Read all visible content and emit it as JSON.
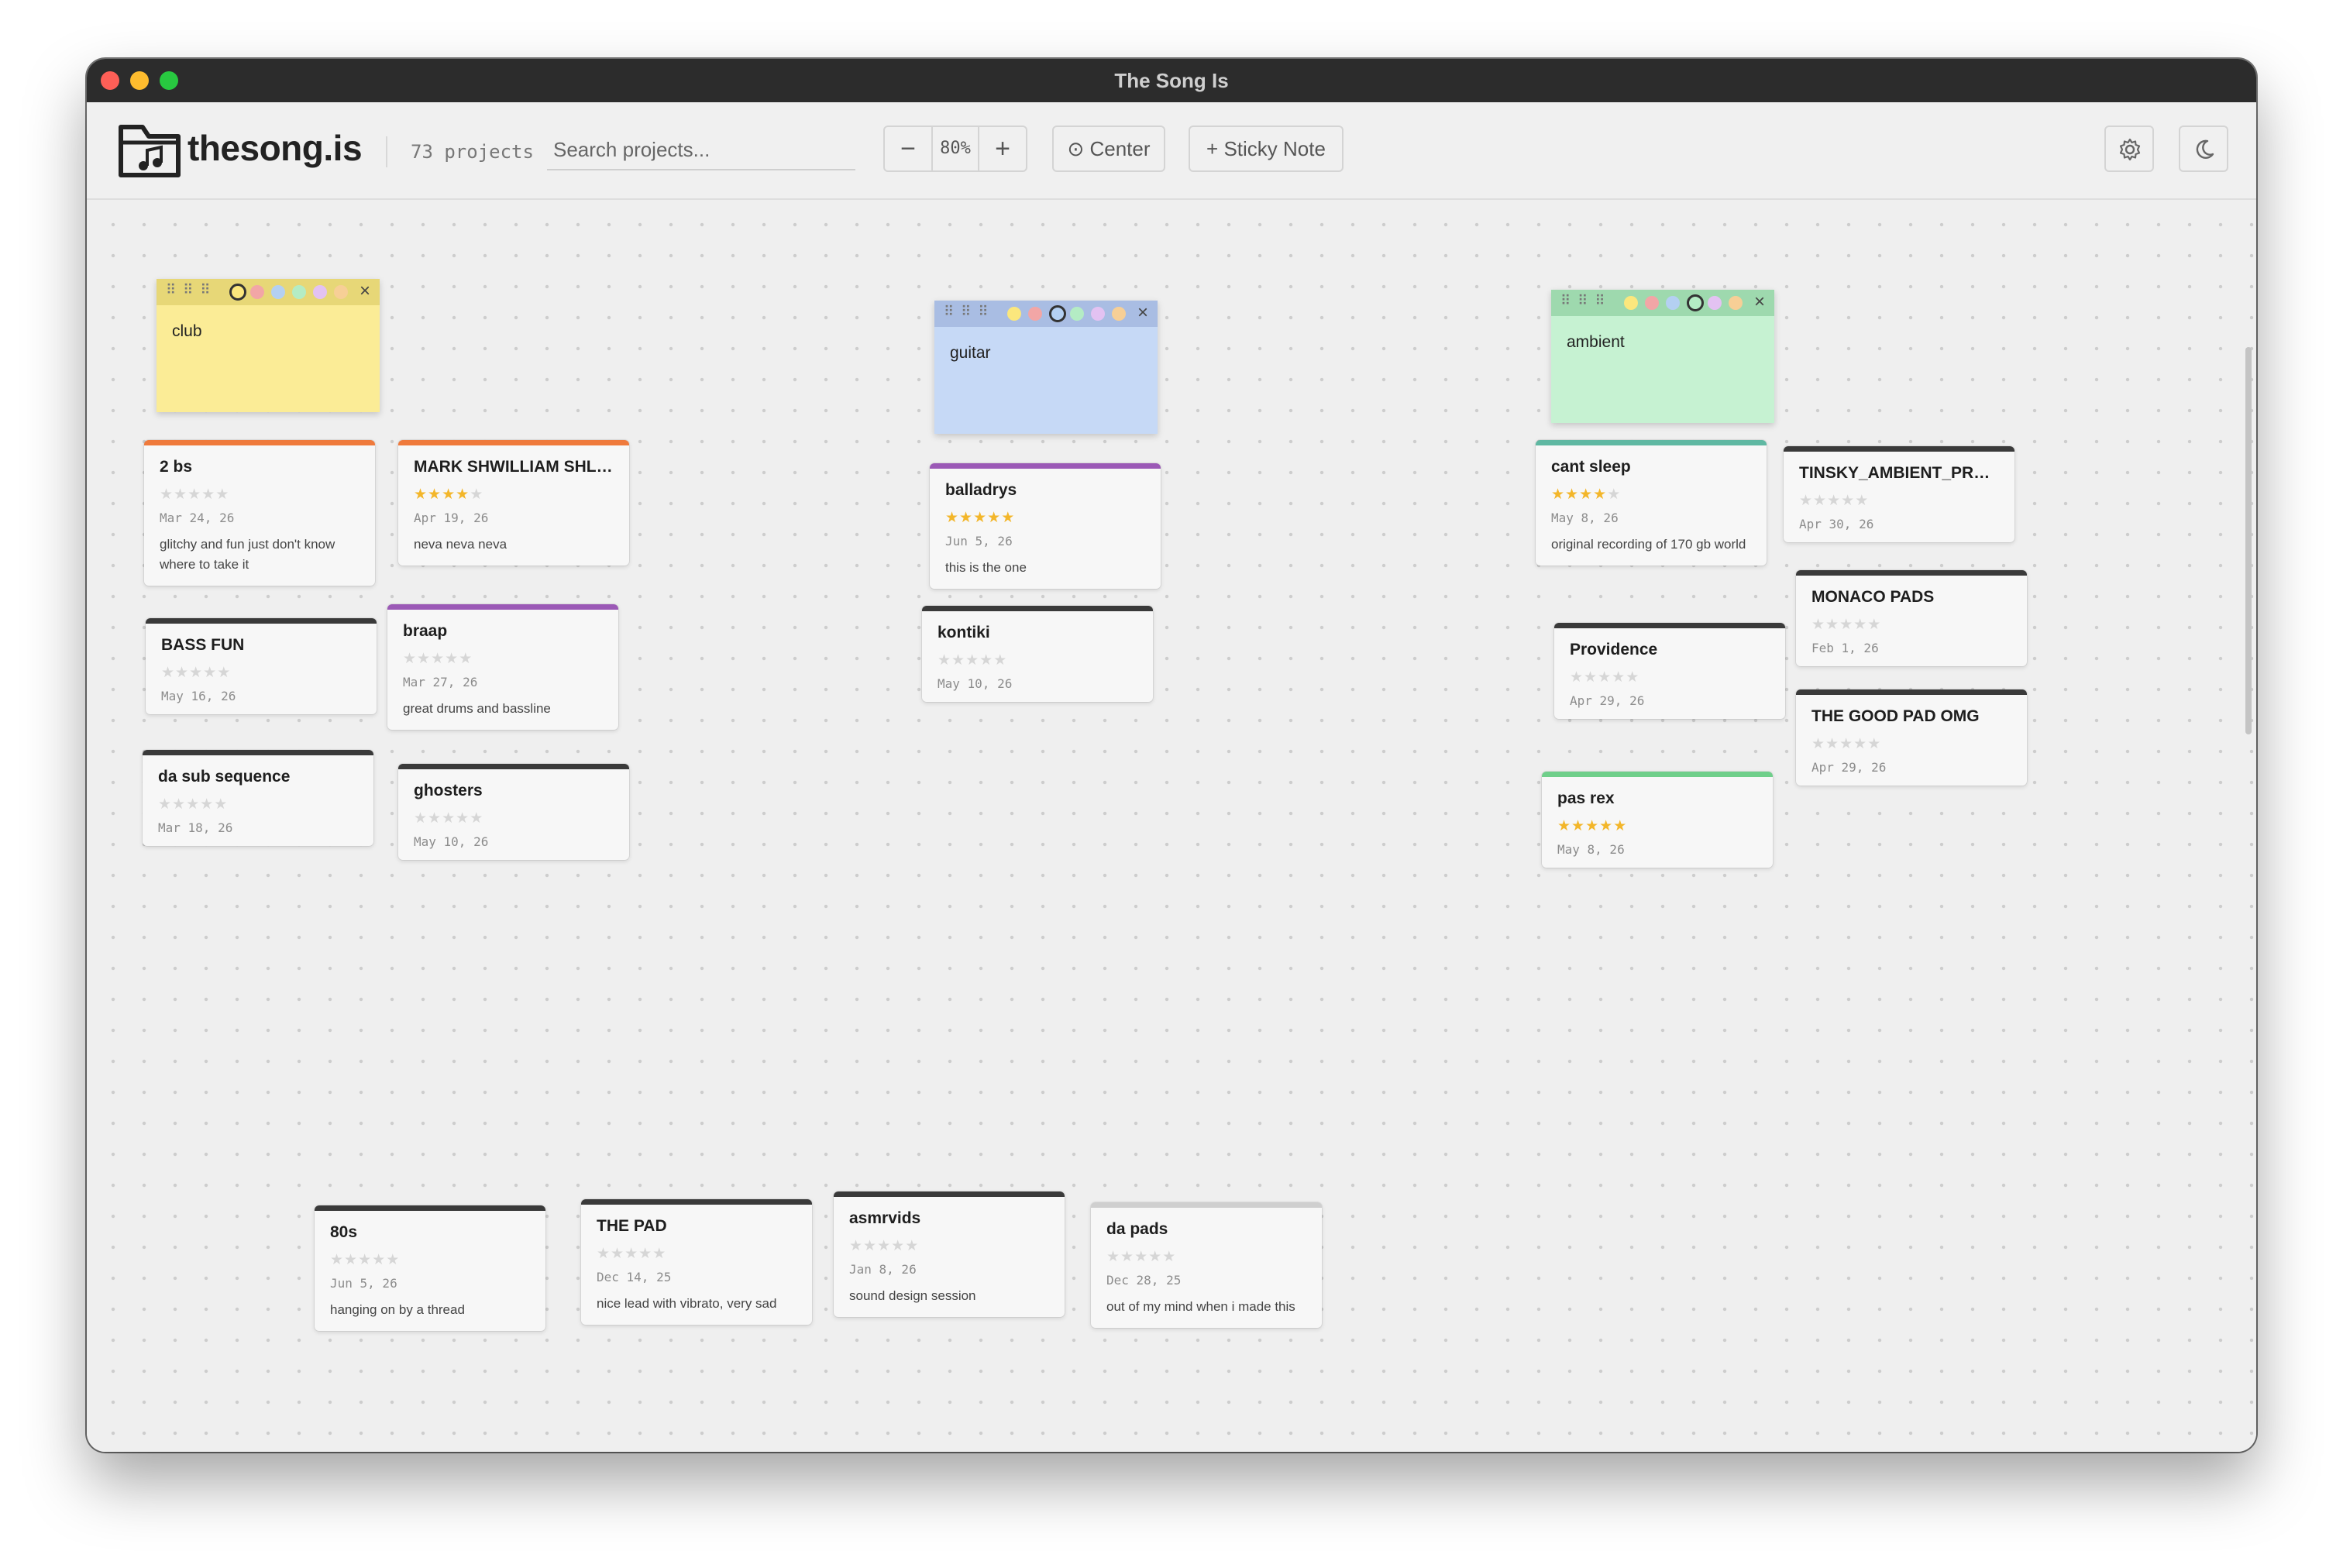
{
  "window": {
    "title": "The Song Is"
  },
  "toolbar": {
    "brand": "thesong.is",
    "project_count": "73 projects",
    "search_placeholder": "Search projects...",
    "zoom": {
      "minus": "−",
      "value": "80%",
      "plus": "+"
    },
    "center_label": "⊙ Center",
    "sticky_label": "+ Sticky Note",
    "settings_icon": "gear-icon",
    "theme_icon": "moon-icon"
  },
  "stickies": [
    {
      "text": "club",
      "color": "#fbec96",
      "head_color": "#e7d777",
      "selected_swatch": 0
    },
    {
      "text": "guitar",
      "color": "#c6d9f6",
      "head_color": "#a9bde3",
      "selected_swatch": 2
    },
    {
      "text": "ambient",
      "color": "#c6f2d2",
      "head_color": "#9ed9ae",
      "selected_swatch": 3
    }
  ],
  "swatch_colors": [
    "#fbe77d",
    "#f2a6a6",
    "#b4d0f2",
    "#b4ecc4",
    "#e3c2f2",
    "#f7cf96"
  ],
  "projects": [
    {
      "title": "2 bs",
      "rating": 0,
      "date": "Mar 24, 26",
      "note": "glitchy and fun just don't know where to take it",
      "accent": "#ef7a3c"
    },
    {
      "title": "MARK SHWILLIAM SHLE...",
      "rating": 4,
      "date": "Apr 19, 26",
      "note": "neva neva neva",
      "accent": "#ef7a3c"
    },
    {
      "title": "BASS FUN",
      "rating": 0,
      "date": "May 16, 26",
      "note": "",
      "accent": "#3a3a3a"
    },
    {
      "title": "braap",
      "rating": 0,
      "date": "Mar 27, 26",
      "note": "great drums and bassline",
      "accent": "#9b59b6"
    },
    {
      "title": "da sub sequence",
      "rating": 0,
      "date": "Mar 18, 26",
      "note": "",
      "accent": "#3a3a3a"
    },
    {
      "title": "ghosters",
      "rating": 0,
      "date": "May 10, 26",
      "note": "",
      "accent": "#3a3a3a"
    },
    {
      "title": "balladrys",
      "rating": 5,
      "date": "Jun 5, 26",
      "note": "this is the one",
      "accent": "#9b59b6"
    },
    {
      "title": "kontiki",
      "rating": 0,
      "date": "May 10, 26",
      "note": "",
      "accent": "#3a3a3a"
    },
    {
      "title": "cant sleep",
      "rating": 4,
      "date": "May 8, 26",
      "note": "original recording of 170 gb world",
      "accent": "#5fb8a2"
    },
    {
      "title": "TINSKY_AMBIENT_PRO...",
      "rating": 0,
      "date": "Apr 30, 26",
      "note": "",
      "accent": "#3a3a3a"
    },
    {
      "title": "MONACO PADS",
      "rating": 0,
      "date": "Feb 1, 26",
      "note": "",
      "accent": "#3a3a3a"
    },
    {
      "title": "Providence",
      "rating": 0,
      "date": "Apr 29, 26",
      "note": "",
      "accent": "#3a3a3a"
    },
    {
      "title": "THE GOOD PAD OMG",
      "rating": 0,
      "date": "Apr 29, 26",
      "note": "",
      "accent": "#3a3a3a"
    },
    {
      "title": "pas rex",
      "rating": 5,
      "date": "May 8, 26",
      "note": "",
      "accent": "#6fcf8a"
    },
    {
      "title": "80s",
      "rating": 0,
      "date": "Jun 5, 26",
      "note": "hanging on by a thread",
      "accent": "#3a3a3a"
    },
    {
      "title": "THE PAD",
      "rating": 0,
      "date": "Dec 14, 25",
      "note": "nice lead with vibrato, very sad",
      "accent": "#3a3a3a"
    },
    {
      "title": "asmrvids",
      "rating": 0,
      "date": "Jan 8, 26",
      "note": "sound design session",
      "accent": "#3a3a3a"
    },
    {
      "title": "da pads",
      "rating": 0,
      "date": "Dec 28, 25",
      "note": "out of my mind when i made this",
      "accent": "#cfcfcf"
    }
  ]
}
